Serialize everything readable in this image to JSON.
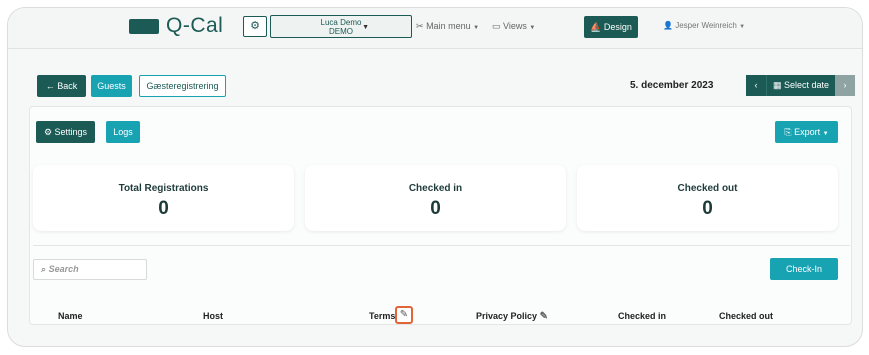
{
  "app": {
    "logo_text": "Q-Cal"
  },
  "navbar": {
    "company_name": "Luca Demo",
    "company_sub": "DEMO",
    "main_menu": "Main menu",
    "views": "Views",
    "design": "Design",
    "user": "Jesper Weinreich"
  },
  "toolbar": {
    "back": "Back",
    "guests": "Guests",
    "guest_registration": "Gæsteregistrering",
    "date": "5. december 2023",
    "select_date": "Select date"
  },
  "panel": {
    "settings": "Settings",
    "logs": "Logs",
    "export": "Export",
    "search_placeholder": "Search",
    "check_in": "Check-In"
  },
  "stats": [
    {
      "label": "Total Registrations",
      "value": "0"
    },
    {
      "label": "Checked in",
      "value": "0"
    },
    {
      "label": "Checked out",
      "value": "0"
    }
  ],
  "table": {
    "columns": [
      "Name",
      "Host",
      "Terms",
      "Privacy Policy",
      "Checked in",
      "Checked out"
    ]
  },
  "colors": {
    "brand": "#1b5a55",
    "accent": "#18a3b3",
    "highlight": "#e0663a"
  }
}
